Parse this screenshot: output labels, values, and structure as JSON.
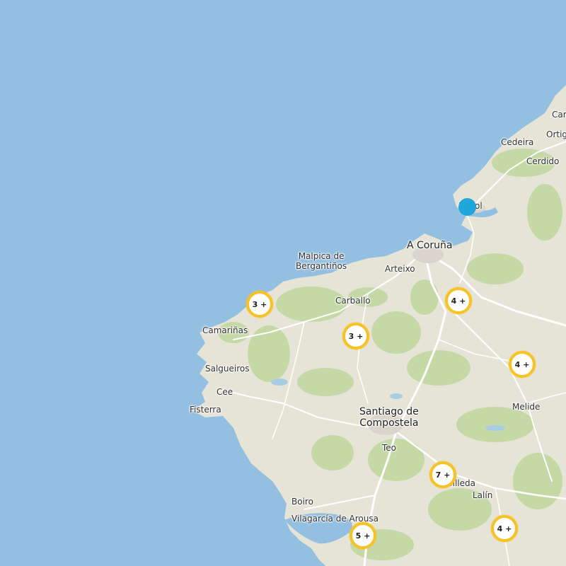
{
  "map": {
    "colors": {
      "sea": "#93bfe0",
      "land": "#e6e4d7",
      "green": "#c4d9a6",
      "road": "#ffffff",
      "cluster_ring": "#f5c328",
      "location_dot": "#1fa7dc"
    },
    "places": {
      "cari": "Cari",
      "ortig": "Ortig",
      "cedeira": "Cedeira",
      "cerdido": "Cerdido",
      "ferrol": "Ferrol",
      "a_coruna": "A Coruña",
      "malpica_1": "Malpica de",
      "malpica_2": "Bergantiños",
      "arteixo": "Arteixo",
      "carballo": "Carballo",
      "camarinas": "Camariñas",
      "salgueiros": "Salgueiros",
      "cee": "Cee",
      "fisterra": "Fisterra",
      "santiago_1": "Santiago de",
      "santiago_2": "Compostela",
      "melide": "Melide",
      "teo": "Teo",
      "silleda": "Silleda",
      "lalin": "Lalín",
      "boiro": "Boiro",
      "vilagarcia": "Vilagarcía de Arousa"
    },
    "clusters": [
      {
        "label": "3 +"
      },
      {
        "label": "4 +"
      },
      {
        "label": "3 +"
      },
      {
        "label": "4 +"
      },
      {
        "label": "7 +"
      },
      {
        "label": "5 +"
      },
      {
        "label": "4 +"
      }
    ],
    "current_location_icon": "location-dot-icon"
  }
}
